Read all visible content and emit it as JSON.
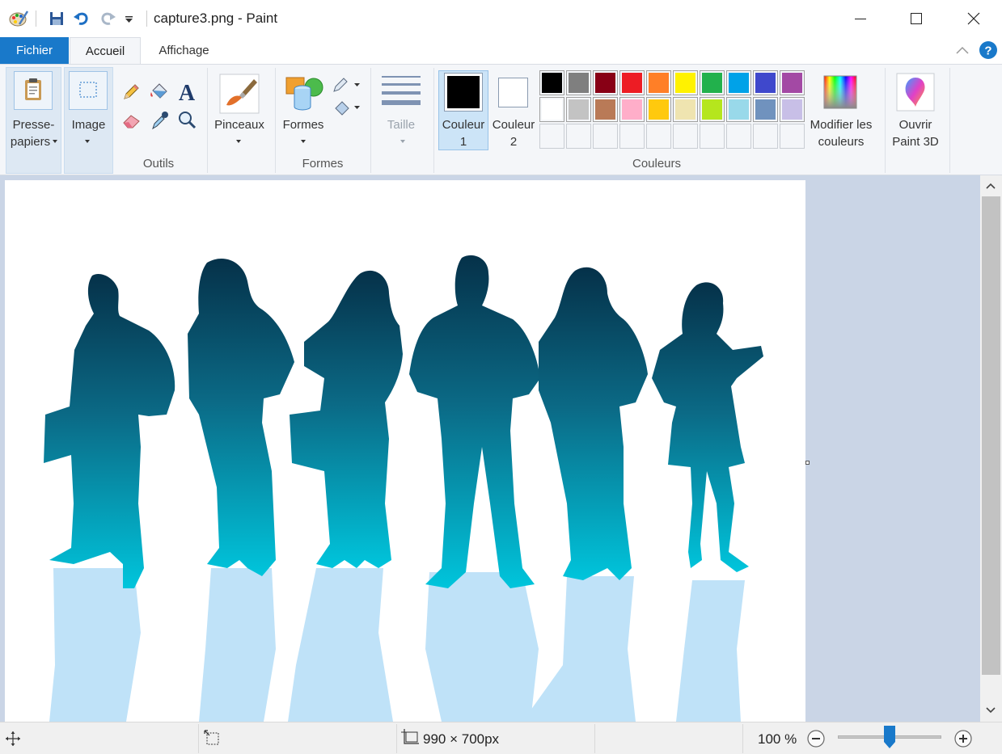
{
  "window": {
    "title": "capture3.png - Paint",
    "minimize_icon": "minimize-icon",
    "maximize_icon": "maximize-icon",
    "close_icon": "close-icon"
  },
  "quick_access": {
    "icons": [
      "paint-app-icon",
      "save-icon",
      "undo-icon",
      "redo-icon",
      "customize-dropdown-icon"
    ]
  },
  "tabs": [
    {
      "label": "Fichier"
    },
    {
      "label": "Accueil"
    },
    {
      "label": "Affichage"
    }
  ],
  "ribbon": {
    "clipboard": {
      "label_line1": "Presse-",
      "label_line2": "papiers"
    },
    "image": {
      "label": "Image"
    },
    "tools": {
      "group_label": "Outils",
      "icons": [
        "pencil-icon",
        "fill-bucket-icon",
        "text-icon",
        "eraser-icon",
        "color-picker-icon",
        "magnifier-icon"
      ]
    },
    "brushes": {
      "label": "Pinceaux"
    },
    "shapes": {
      "label": "Formes",
      "group_label": "Formes"
    },
    "size": {
      "label": "Taille"
    },
    "colors": {
      "color1_line1": "Couleur",
      "color1_line2": "1",
      "color2_line1": "Couleur",
      "color2_line2": "2",
      "group_label": "Couleurs",
      "palette_row1": [
        "#000000",
        "#7f7f7f",
        "#880015",
        "#ed1c24",
        "#ff7f27",
        "#fff200",
        "#22b14c",
        "#00a2e8",
        "#3f48cc",
        "#a349a4"
      ],
      "palette_row2": [
        "#ffffff",
        "#c3c3c3",
        "#b97a57",
        "#ffaec9",
        "#ffc90e",
        "#efe4b0",
        "#b5e61d",
        "#99d9ea",
        "#7092be",
        "#c8bfe7"
      ],
      "color1_value": "#000000",
      "color2_value": "#ffffff"
    },
    "edit_colors": {
      "label_line1": "Modifier les",
      "label_line2": "couleurs"
    },
    "paint3d": {
      "label_line1": "Ouvrir",
      "label_line2": "Paint 3D"
    }
  },
  "status": {
    "image_size": "990 × 700px",
    "zoom": "100 %",
    "zoom_fraction": 0.5
  }
}
